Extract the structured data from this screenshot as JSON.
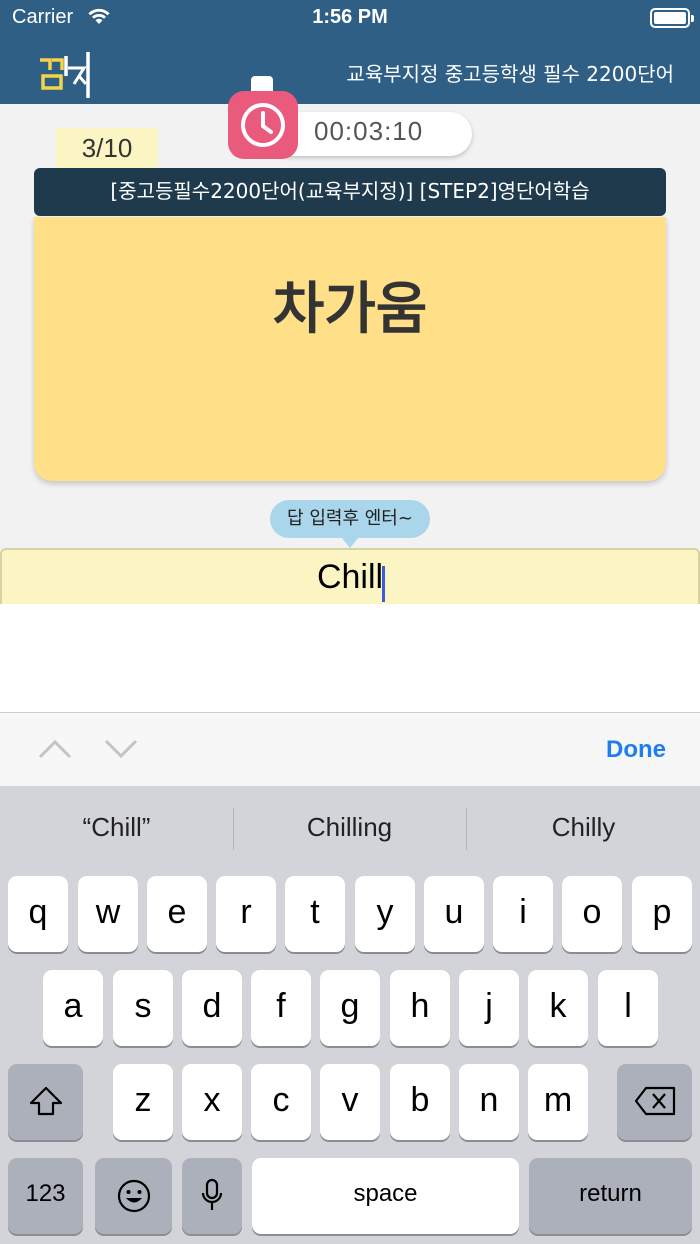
{
  "status": {
    "carrier": "Carrier",
    "time": "1:56 PM"
  },
  "header": {
    "title": "교육부지정 중고등학생 필수 2200단어"
  },
  "timer": {
    "value": "00:03:10"
  },
  "progress": {
    "counter": "3/10"
  },
  "card": {
    "course": "[중고등필수2200단어(교육부지정)] [STEP2]영단어학습",
    "word": "차가움"
  },
  "answer": {
    "hint": "답 입력후 엔터~",
    "value": "Chill"
  },
  "accessory": {
    "done": "Done"
  },
  "keyboard": {
    "suggestions": [
      "“Chill”",
      "Chilling",
      "Chilly"
    ],
    "row1": [
      "q",
      "w",
      "e",
      "r",
      "t",
      "y",
      "u",
      "i",
      "o",
      "p"
    ],
    "row2": [
      "a",
      "s",
      "d",
      "f",
      "g",
      "h",
      "j",
      "k",
      "l"
    ],
    "row3": [
      "z",
      "x",
      "c",
      "v",
      "b",
      "n",
      "m"
    ],
    "numbers": "123",
    "space": "space",
    "return": "return"
  },
  "colors": {
    "header": "#2f5f85",
    "card": "#ffe088",
    "timer": "#ea5a7c",
    "done": "#1e7ef0"
  }
}
